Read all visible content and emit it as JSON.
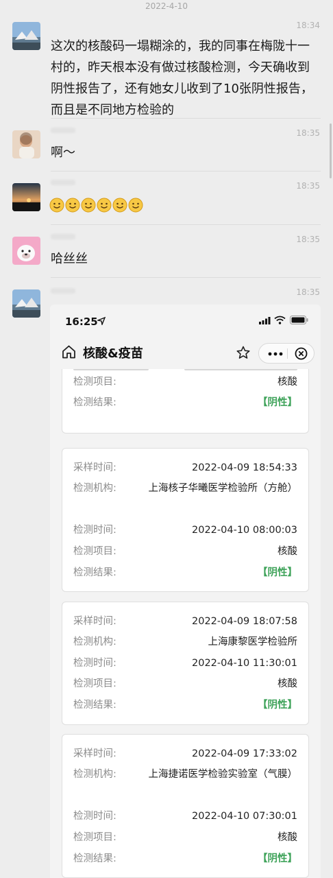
{
  "chat": {
    "date_separator": "2022-4-10",
    "messages": [
      {
        "time": "18:34",
        "text": "这次的核酸码一塌糊涂的，我的同事在梅陇十一村的，昨天根本没有做过核酸检测，今天确收到阴性报告了，还有她女儿收到了10张阴性报告，而且是不同地方检验的"
      },
      {
        "time": "18:35",
        "text": "啊～"
      },
      {
        "time": "18:35",
        "emojis": [
          "smile-emoji",
          "smile-emoji",
          "smile-emoji",
          "smile-emoji",
          "smile-emoji",
          "smile-emoji"
        ]
      },
      {
        "time": "18:35",
        "text": "哈丝丝"
      },
      {
        "time": "18:35"
      }
    ]
  },
  "screenshot": {
    "status_time": "16:25",
    "nav_title": "核酸&疫苗",
    "labels": {
      "sample_time": "采样时间:",
      "institution": "检测机构:",
      "test_time": "检测时间:",
      "test_item": "检测项目:",
      "test_result": "检测结果:"
    },
    "cards": [
      {
        "test_item": "核酸",
        "result": "【阴性】"
      },
      {
        "sample_time": "2022-04-09 18:54:33",
        "institution": "上海核子华曦医学检验所（方舱）",
        "test_time": "2022-04-10 08:00:03",
        "test_item": "核酸",
        "result": "【阴性】"
      },
      {
        "sample_time": "2022-04-09 18:07:58",
        "institution": "上海康黎医学检验所",
        "test_time": "2022-04-10 11:30:01",
        "test_item": "核酸",
        "result": "【阴性】"
      },
      {
        "sample_time": "2022-04-09 17:33:02",
        "institution": "上海捷诺医学检验实验室（气膜）",
        "test_time": "2022-04-10 07:30:01",
        "test_item": "核酸",
        "result": "【阴性】"
      }
    ]
  },
  "colors": {
    "background": "#ededed",
    "negative_result": "#3fa35a",
    "label": "#8b8b8b"
  }
}
